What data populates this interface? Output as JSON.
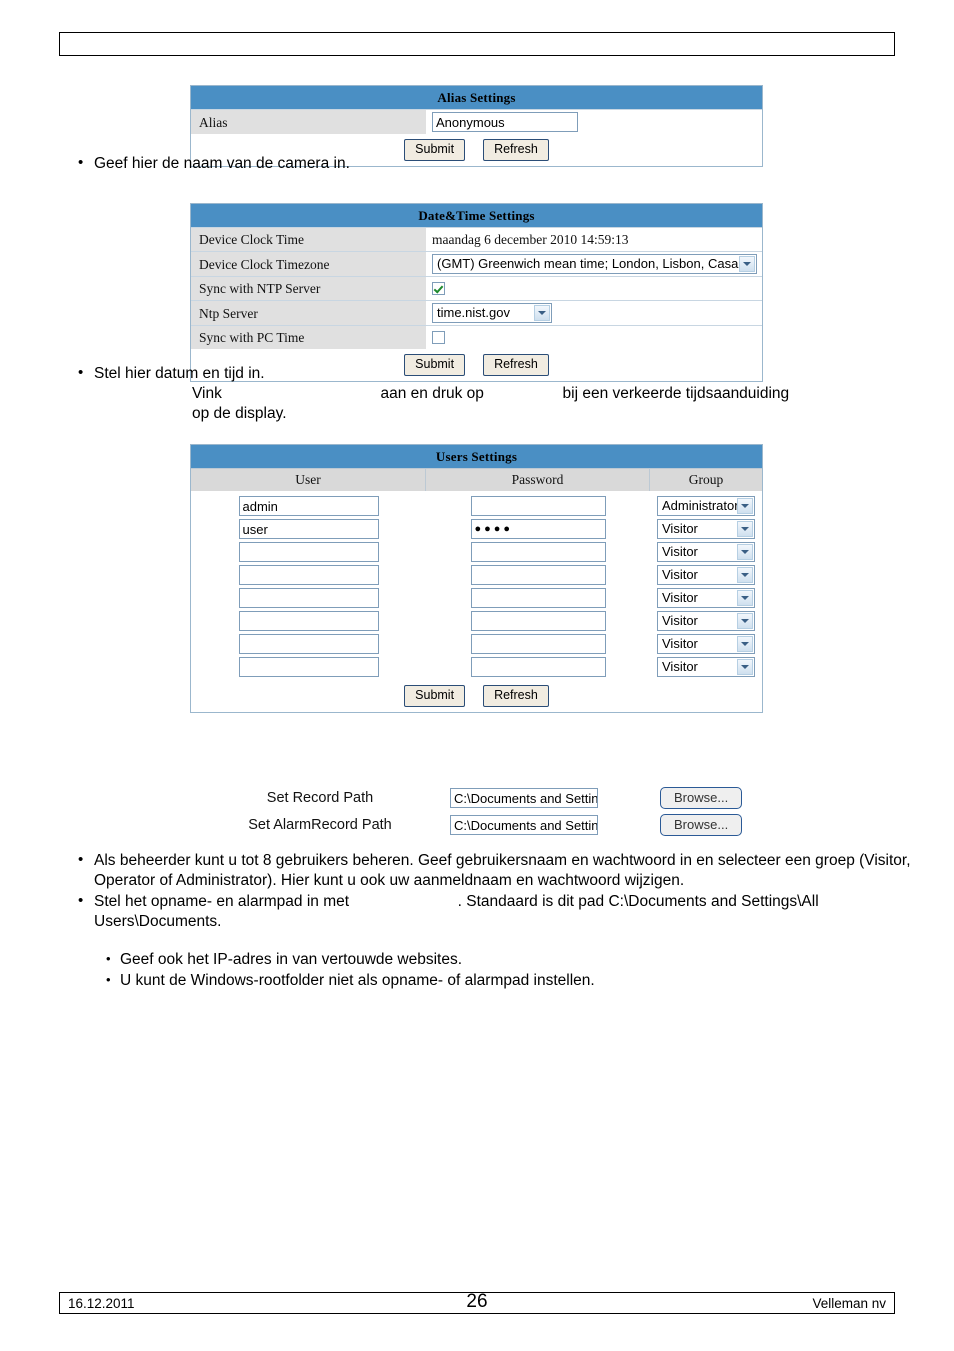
{
  "page": {
    "header_text": "",
    "footer": {
      "date": "16.12.2011",
      "page_number": "26",
      "company": "Velleman nv"
    }
  },
  "alias_panel": {
    "title": "Alias Settings",
    "label": "Alias",
    "value": "Anonymous",
    "submit_label": "Submit",
    "refresh_label": "Refresh"
  },
  "datetime_panel": {
    "title": "Date&Time Settings",
    "rows": [
      {
        "label": "Device Clock Time",
        "value": "maandag 6 december 2010 14:59:13"
      },
      {
        "label": "Device Clock Timezone",
        "value": "(GMT) Greenwich mean time; London, Lisbon, Casablan"
      },
      {
        "label": "Sync with NTP Server",
        "value": ""
      },
      {
        "label": "Ntp Server",
        "value": "time.nist.gov"
      },
      {
        "label": "Sync with PC Time",
        "value": ""
      }
    ],
    "ntp_checked": true,
    "pc_time_checked": false,
    "submit_label": "Submit",
    "refresh_label": "Refresh"
  },
  "users_panel": {
    "title": "Users Settings",
    "columns": [
      "User",
      "Password",
      "Group"
    ],
    "rows": [
      {
        "user": "admin",
        "password": "",
        "group": "Administrator"
      },
      {
        "user": "user",
        "password": "●●●●",
        "group": "Visitor"
      },
      {
        "user": "",
        "password": "",
        "group": "Visitor"
      },
      {
        "user": "",
        "password": "",
        "group": "Visitor"
      },
      {
        "user": "",
        "password": "",
        "group": "Visitor"
      },
      {
        "user": "",
        "password": "",
        "group": "Visitor"
      },
      {
        "user": "",
        "password": "",
        "group": "Visitor"
      },
      {
        "user": "",
        "password": "",
        "group": "Visitor"
      }
    ],
    "submit_label": "Submit",
    "refresh_label": "Refresh"
  },
  "paths": {
    "record": {
      "label": "Set Record Path",
      "value": "C:\\Documents and Setting",
      "browse_label": "Browse..."
    },
    "alarm_record": {
      "label": "Set AlarmRecord Path",
      "value": "C:\\Documents and Setting",
      "browse_label": "Browse..."
    }
  },
  "body_text": {
    "alias_note": "Geef hier de naam van de camera in.",
    "datetime_note": "Stel hier datum en tijd in.",
    "datetime_note_line2_a": "Vink",
    "datetime_note_line2_b": "aan en druk op",
    "datetime_note_line2_c": "bij een verkeerde tijdsaanduiding",
    "datetime_note_line3": "op de display.",
    "users_note": "Als beheerder kunt u tot 8 gebruikers beheren. Geef gebruikersnaam en wachtwoord in en selecteer een groep (Visitor, Operator of Administrator). Hier kunt u ook uw aanmeldnaam en wachtwoord wijzigen.",
    "path_note_a": "Stel het opname- en alarmpad in met",
    "path_note_b": ". Standaard is dit pad C:\\Documents and Settings\\All Users\\Documents.",
    "sub_note_1": "Geef ook het IP-adres in van vertouwde websites.",
    "sub_note_2": "U kunt de Windows-rootfolder niet als opname- of alarmpad instellen."
  }
}
